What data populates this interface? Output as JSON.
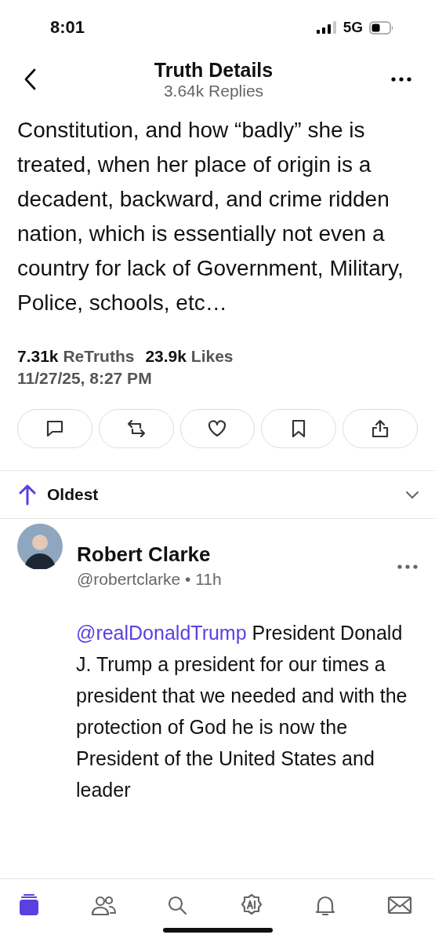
{
  "status_bar": {
    "time": "8:01",
    "network": "5G"
  },
  "header": {
    "title": "Truth Details",
    "subtitle": "3.64k Replies"
  },
  "post": {
    "text": "Constitution, and how “badly” she is treated, when her place of origin is a decadent, backward, and crime ridden nation, which is essentially not even a country for lack of Government, Military, Police, schools, etc…",
    "stats": [
      {
        "count": "7.31k",
        "label": "ReTruths"
      },
      {
        "count": "23.9k",
        "label": "Likes"
      }
    ],
    "date": "11/27/25, 8:27 PM"
  },
  "actions": [
    {
      "kind": "reply"
    },
    {
      "kind": "retruth"
    },
    {
      "kind": "like"
    },
    {
      "kind": "bookmark"
    },
    {
      "kind": "share"
    }
  ],
  "sort": {
    "label": "Oldest"
  },
  "reply": {
    "name": "Robert Clarke",
    "handle": "@robertclarke • 11h",
    "mention": "@realDonaldTrump",
    "text": "President Donald J. Trump a president for our times a president that we needed and with the protection of God he is now the President of the United States and leader"
  },
  "tab_bar": [
    {
      "kind": "home",
      "selected": true
    },
    {
      "kind": "groups",
      "selected": false
    },
    {
      "kind": "search",
      "selected": false
    },
    {
      "kind": "ai",
      "selected": false
    },
    {
      "kind": "notifications",
      "selected": false
    },
    {
      "kind": "messages",
      "selected": false
    }
  ]
}
